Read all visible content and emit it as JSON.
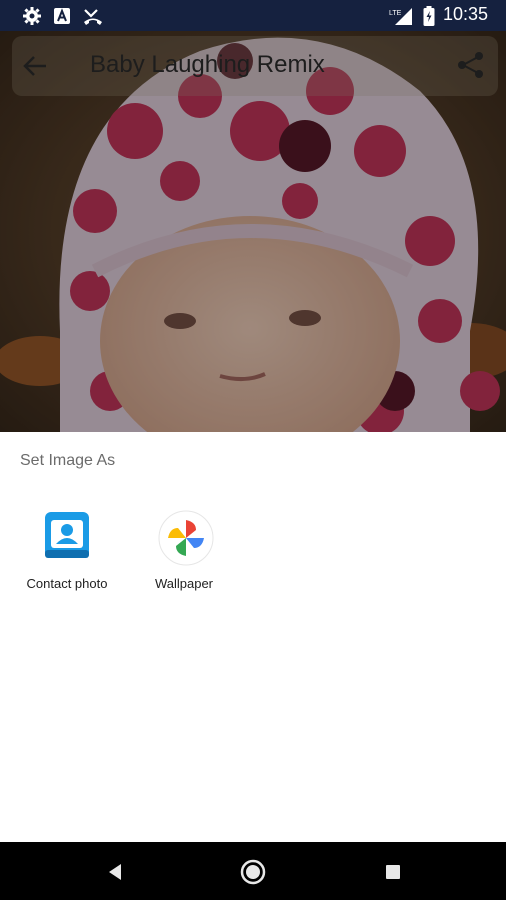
{
  "status_bar": {
    "time": "10:35",
    "left_icons": [
      "gear-icon",
      "font-a-icon",
      "missed-call-icon"
    ],
    "right_icons": [
      "lte-signal-icon",
      "battery-icon"
    ]
  },
  "app_bar": {
    "title": "Baby Laughing Remix",
    "back_icon": "arrow-back-icon",
    "share_icon": "share-icon"
  },
  "sheet": {
    "title": "Set Image As",
    "targets": [
      {
        "label": "Contact photo",
        "icon": "contact-photo-icon"
      },
      {
        "label": "Wallpaper",
        "icon": "google-photos-pinwheel-icon"
      }
    ]
  },
  "nav_bar": {
    "buttons": [
      "back-triangle-icon",
      "home-circle-icon",
      "recents-square-icon"
    ]
  },
  "colors": {
    "status_bg": "#15213f",
    "sheet_bg": "#ffffff",
    "nav_bg": "#000000",
    "contact_blue": "#1a9be6"
  }
}
